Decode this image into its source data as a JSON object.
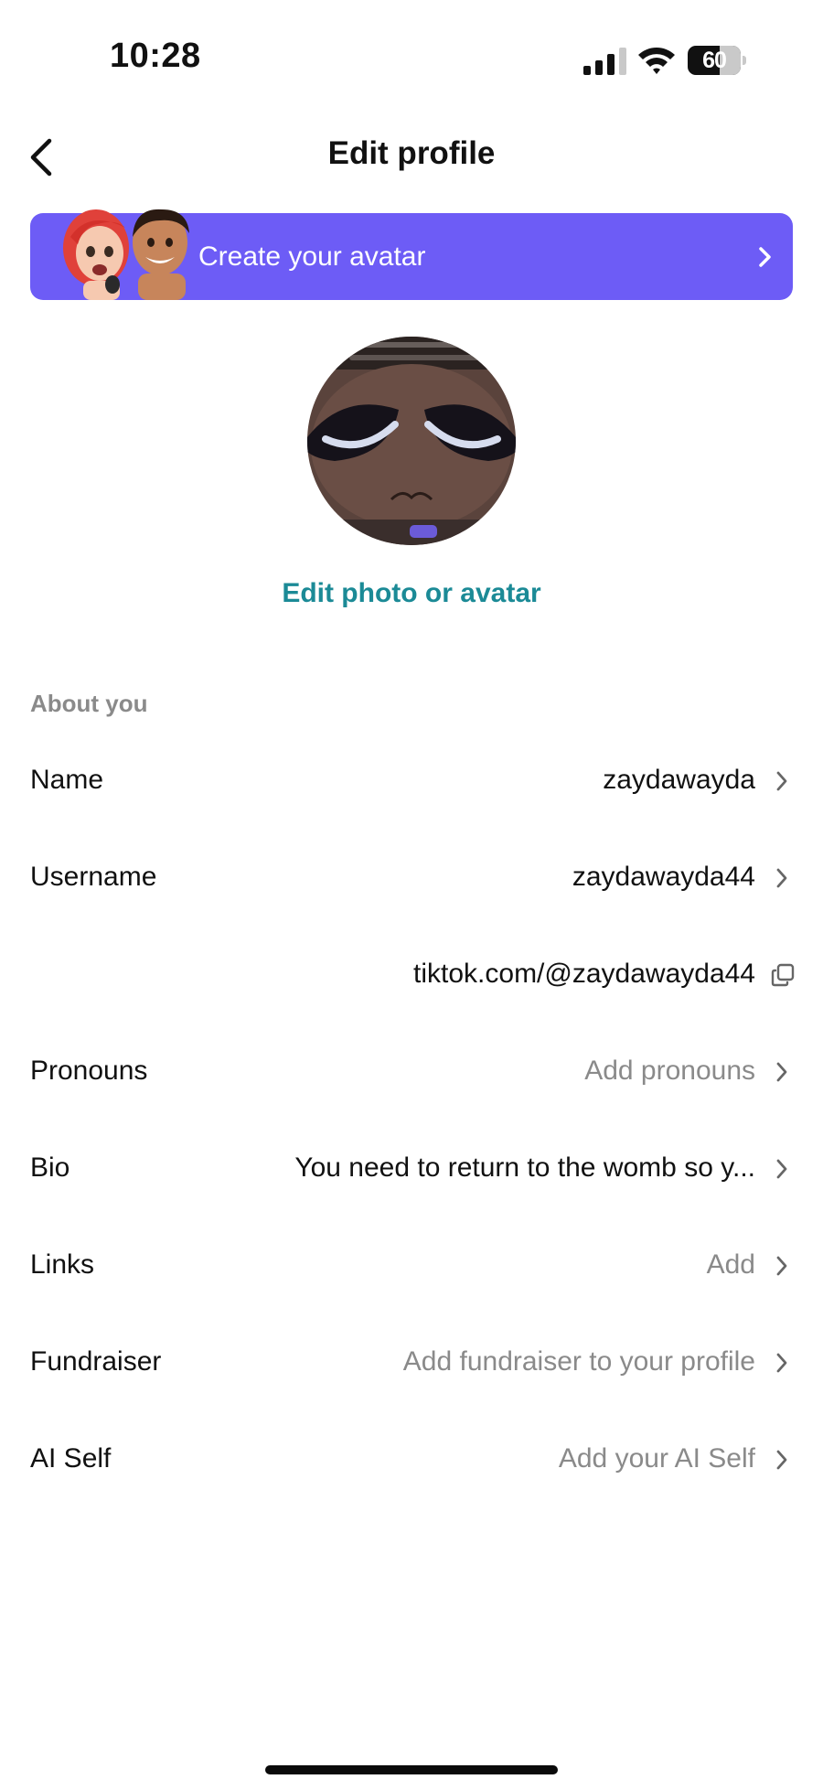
{
  "status_bar": {
    "time": "10:28",
    "battery_level": "60",
    "battery_fraction": 0.6,
    "icons": [
      "cellular-signal-icon",
      "wifi-icon",
      "battery-icon"
    ]
  },
  "header": {
    "title": "Edit profile",
    "back_icon": "chevron-left-icon"
  },
  "avatar_banner": {
    "label": "Create your avatar",
    "background_color": "#6d5cf6",
    "icon": "chevron-right-icon"
  },
  "profile_photo": {
    "edit_label": "Edit photo or avatar",
    "link_color": "#1b8a96"
  },
  "about_section": {
    "title": "About you",
    "fields": [
      {
        "label": "Name",
        "value": "zaydawayda",
        "placeholder": false,
        "action_icon": "chevron-right-icon"
      },
      {
        "label": "Username",
        "value": "zaydawayda44",
        "placeholder": false,
        "action_icon": "chevron-right-icon"
      },
      {
        "label": "",
        "value": "tiktok.com/@zaydawayda44",
        "placeholder": false,
        "action_icon": "copy-icon"
      },
      {
        "label": "Pronouns",
        "value": "Add pronouns",
        "placeholder": true,
        "action_icon": "chevron-right-icon"
      },
      {
        "label": "Bio",
        "value": "You need to return to the womb so y...",
        "placeholder": false,
        "action_icon": "chevron-right-icon"
      },
      {
        "label": "Links",
        "value": "Add",
        "placeholder": true,
        "action_icon": "chevron-right-icon"
      },
      {
        "label": "Fundraiser",
        "value": "Add fundraiser to your profile",
        "placeholder": true,
        "action_icon": "chevron-right-icon"
      },
      {
        "label": "AI Self",
        "value": "Add your AI Self",
        "placeholder": true,
        "action_icon": "chevron-right-icon"
      }
    ]
  }
}
